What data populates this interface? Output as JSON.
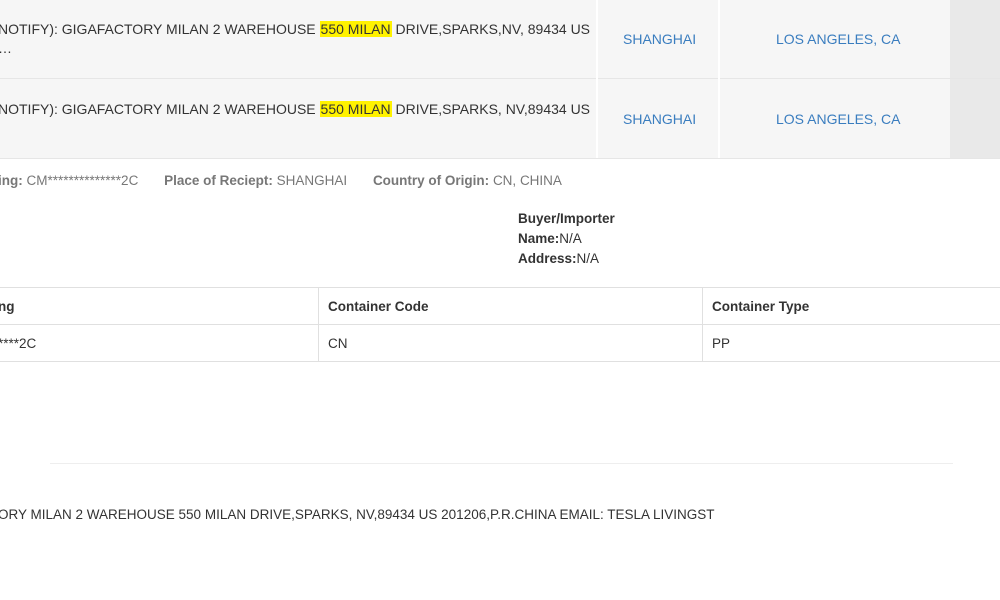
{
  "results": [
    {
      "address_before": "NOTIFY): GIGAFACTORY MILAN 2 WAREHOUSE ",
      "address_highlight": "550 MILAN",
      "address_after": " DRIVE,SPARKS,NV, 89434 US",
      "address_more": "…",
      "origin": "SHANGHAI",
      "destination": "LOS ANGELES, CA"
    },
    {
      "address_before": "NOTIFY): GIGAFACTORY MILAN 2 WAREHOUSE ",
      "address_highlight": "550 MILAN",
      "address_after": " DRIVE,SPARKS, NV,89434 US",
      "origin": "SHANGHAI",
      "destination": "LOS ANGELES, CA"
    }
  ],
  "details": {
    "bill_label": "ing:",
    "bill_value": "CM**************2C",
    "receipt_label": "Place of Reciept:",
    "receipt_value": "SHANGHAI",
    "origin_label": "Country of Origin:",
    "origin_value": "CN, CHINA"
  },
  "buyer": {
    "title": "Buyer/Importer",
    "name_label": "Name:",
    "name_value": "N/A",
    "address_label": "Address:",
    "address_value": "N/A"
  },
  "container_table": {
    "headers": [
      "ng",
      "Container Code",
      "Container Type"
    ],
    "row": [
      "****2C",
      "CN",
      "PP"
    ]
  },
  "bottom_address": "ORY MILAN 2 WAREHOUSE 550 MILAN DRIVE,SPARKS, NV,89434 US 201206,P.R.CHINA EMAIL: TESLA LIVINGST"
}
